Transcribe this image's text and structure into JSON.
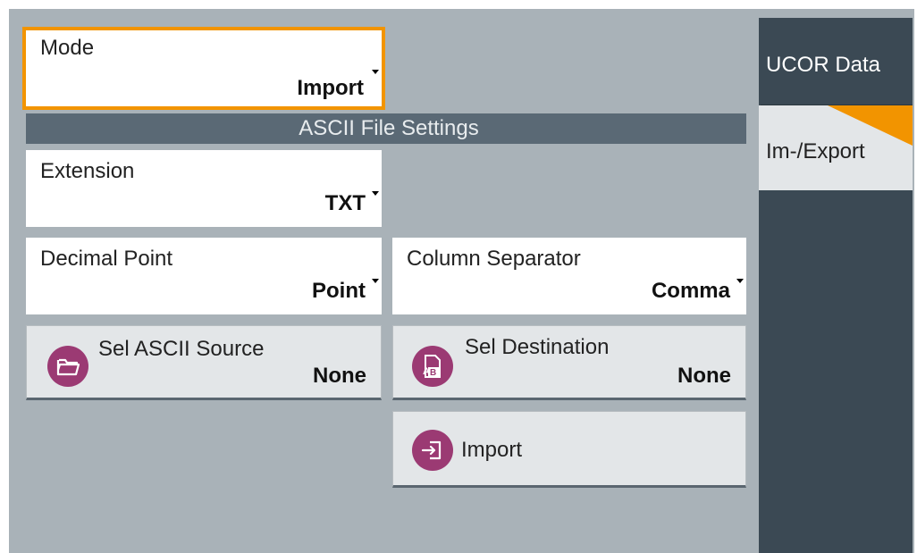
{
  "mode": {
    "label": "Mode",
    "value": "Import"
  },
  "section_title": "ASCII File Settings",
  "extension": {
    "label": "Extension",
    "value": "TXT"
  },
  "decimal_point": {
    "label": "Decimal Point",
    "value": "Point"
  },
  "column_separator": {
    "label": "Column Separator",
    "value": "Comma"
  },
  "sel_ascii_source": {
    "label": "Sel ASCII Source",
    "value": "None",
    "icon": "folder-icon"
  },
  "sel_destination": {
    "label": "Sel Destination",
    "value": "None",
    "icon": "document-ab-icon"
  },
  "import_button": {
    "label": "Import",
    "icon": "import-icon"
  },
  "tabs": [
    {
      "label": "UCOR Data"
    },
    {
      "label": "Im-/Export"
    }
  ],
  "colors": {
    "accent": "#f29400",
    "icon_bg": "#9b3a73",
    "sidebar": "#3b4954",
    "section_bar": "#5a6975"
  }
}
